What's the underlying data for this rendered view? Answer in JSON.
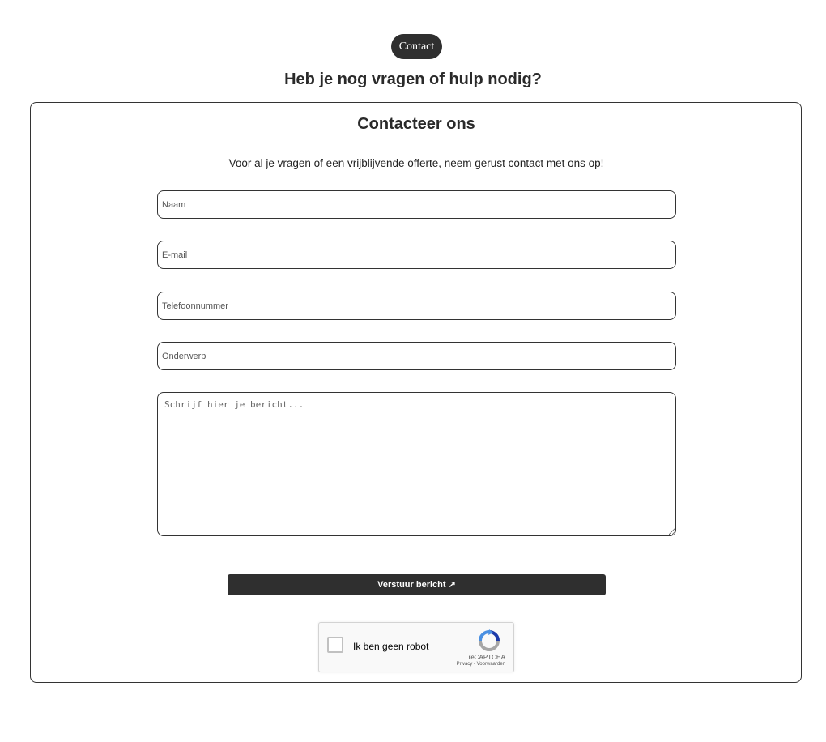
{
  "badge": {
    "label": "Contact"
  },
  "headline": "Heb je nog vragen of hulp nodig?",
  "card": {
    "title": "Contacteer ons",
    "intro": "Voor al je vragen of een vrijblijvende offerte, neem gerust contact met ons op!"
  },
  "form": {
    "name_placeholder": "Naam",
    "email_placeholder": "E-mail",
    "phone_placeholder": "Telefoonnummer",
    "subject_placeholder": "Onderwerp",
    "message_placeholder": "Schrijf hier je bericht...",
    "submit_label": "Verstuur bericht ↗"
  },
  "recaptcha": {
    "label": "Ik ben geen robot",
    "brand": "reCAPTCHA",
    "privacy": "Privacy",
    "separator": " - ",
    "terms": "Voorwaarden",
    "logo_icon": "recaptcha-logo-icon",
    "colors": {
      "blue": "#4a90e2",
      "dark_blue": "#1c3aa9",
      "grey": "#a6a6a6"
    }
  },
  "colors": {
    "dark": "#2f2f2f",
    "border": "#333333",
    "background": "#ffffff"
  }
}
